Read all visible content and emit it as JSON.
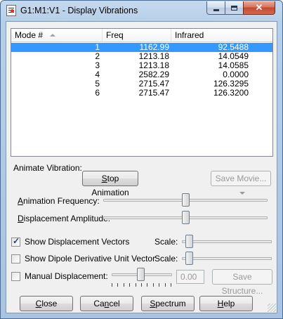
{
  "window": {
    "title": "G1:M1:V1 - Display Vibrations"
  },
  "list": {
    "columns": [
      "Mode #",
      "Freq",
      "Infrared"
    ],
    "rows": [
      {
        "mode": "1",
        "freq": "1162.99",
        "ir": "92.5488",
        "selected": true
      },
      {
        "mode": "2",
        "freq": "1213.18",
        "ir": "14.0549"
      },
      {
        "mode": "3",
        "freq": "1213.18",
        "ir": "14.0585"
      },
      {
        "mode": "4",
        "freq": "2582.29",
        "ir": "0.0000"
      },
      {
        "mode": "5",
        "freq": "2715.47",
        "ir": "126.3295"
      },
      {
        "mode": "6",
        "freq": "2715.47",
        "ir": "126.3200"
      }
    ]
  },
  "animate": {
    "label": "Animate Vibration:",
    "stop_button": "Stop Animation",
    "save_movie": "Save Movie...",
    "frequency_label": "Animation Frequency:",
    "frequency_level": 0.5,
    "amplitude_label": "Displacement Amplitude:",
    "amplitude_level": 0.5
  },
  "options": {
    "show_vectors_label": "Show Displacement Vectors",
    "show_vectors_checked": true,
    "show_dipole_label": "Show Dipole Derivative Unit Vector",
    "show_dipole_checked": false,
    "scale_label": "Scale:",
    "manual_label": "Manual Displacement:",
    "manual_checked": false,
    "manual_value": "0.00",
    "save_structure": "Save Structure..."
  },
  "buttons": {
    "close": "Close",
    "cancel": "Cancel",
    "spectrum": "Spectrum",
    "help": "Help"
  }
}
